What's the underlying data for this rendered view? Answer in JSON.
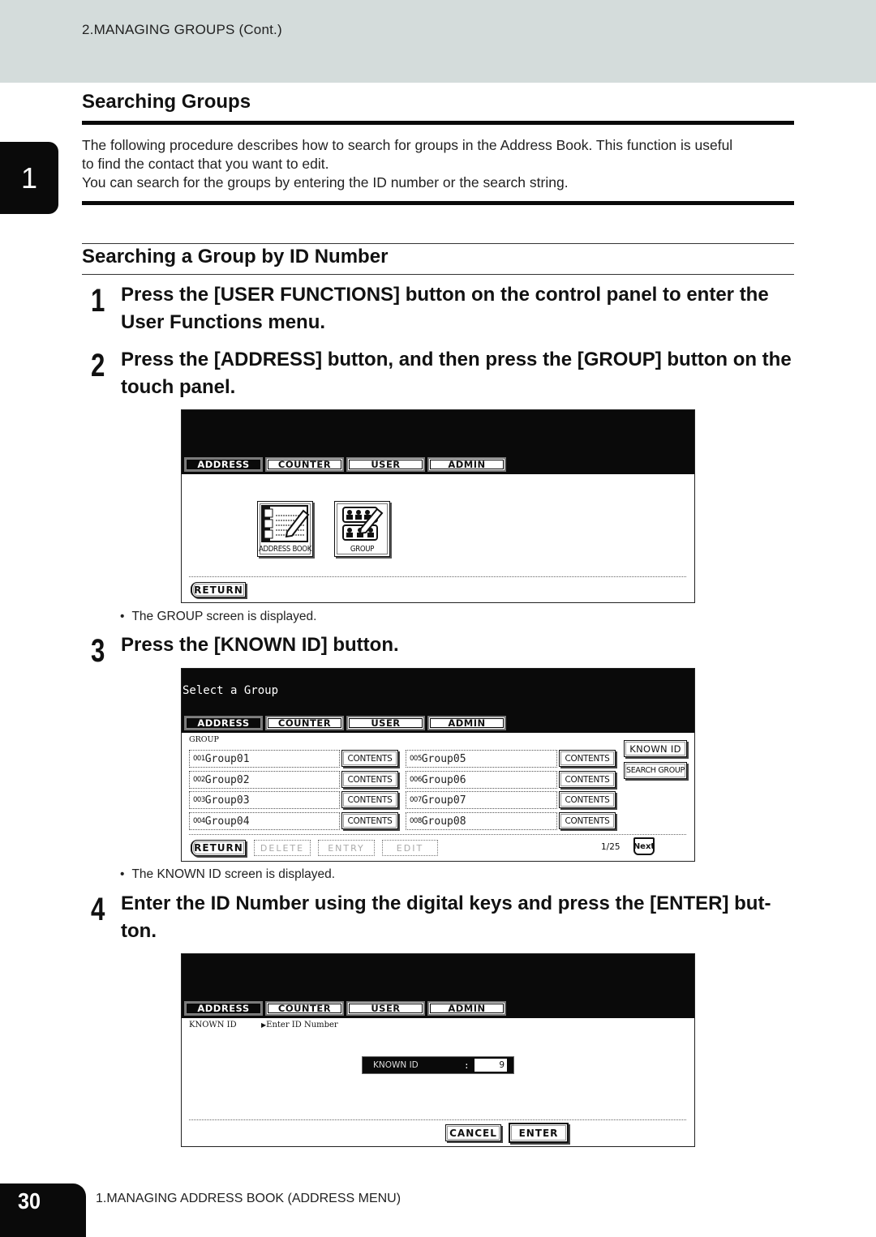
{
  "header": {
    "running_title": "2.MANAGING GROUPS (Cont.)"
  },
  "chapter_tab": "1",
  "section": {
    "title": "Searching Groups",
    "intro": [
      "The following procedure describes how to search for groups in the Address Book.  This function is useful",
      "to find the contact that you want to edit.",
      "You can search for the groups by entering the ID number or the search string."
    ]
  },
  "subsection": {
    "title": "Searching a Group by ID Number"
  },
  "steps": [
    {
      "num": "1",
      "text": "Press the [USER FUNCTIONS] button on the control panel to enter the User Functions menu."
    },
    {
      "num": "2",
      "text": "Press the [ADDRESS] button, and then press the [GROUP] button on the touch panel."
    },
    {
      "num": "3",
      "text": "Press the [KNOWN ID] button."
    },
    {
      "num": "4",
      "text": "Enter the ID Number using the digital keys and press the [ENTER] but- ton."
    }
  ],
  "notes": {
    "after_step2": "The GROUP screen is displayed.",
    "after_step3": "The KNOWN ID screen is displayed."
  },
  "tabs": [
    "ADDRESS",
    "COUNTER",
    "USER",
    "ADMIN"
  ],
  "screen1": {
    "icons": [
      {
        "label": "ADDRESS BOOK",
        "icon": "address-book-icon"
      },
      {
        "label": "GROUP",
        "icon": "group-icon"
      }
    ],
    "return_label": "RETURN"
  },
  "screen2": {
    "title": "Select a Group",
    "section_label": "GROUP",
    "groups": [
      {
        "id": "001",
        "name": "Group01"
      },
      {
        "id": "002",
        "name": "Group02"
      },
      {
        "id": "003",
        "name": "Group03"
      },
      {
        "id": "004",
        "name": "Group04"
      },
      {
        "id": "005",
        "name": "Group05"
      },
      {
        "id": "006",
        "name": "Group06"
      },
      {
        "id": "007",
        "name": "Group07"
      },
      {
        "id": "008",
        "name": "Group08"
      }
    ],
    "contents_label": "CONTENTS",
    "known_id_label": "KNOWN ID",
    "search_group_label": "SEARCH GROUP",
    "return_label": "RETURN",
    "delete_label": "DELETE",
    "entry_label": "ENTRY",
    "edit_label": "EDIT",
    "page": "1/25",
    "next_label": "Next"
  },
  "screen3": {
    "label": "KNOWN ID",
    "prompt": "Enter ID Number",
    "field_label": "KNOWN ID",
    "field_colon": ":",
    "field_value": "9",
    "cancel_label": "CANCEL",
    "enter_label": "ENTER"
  },
  "footer": {
    "page_number": "30",
    "chapter_title": "1.MANAGING ADDRESS BOOK (ADDRESS MENU)"
  }
}
